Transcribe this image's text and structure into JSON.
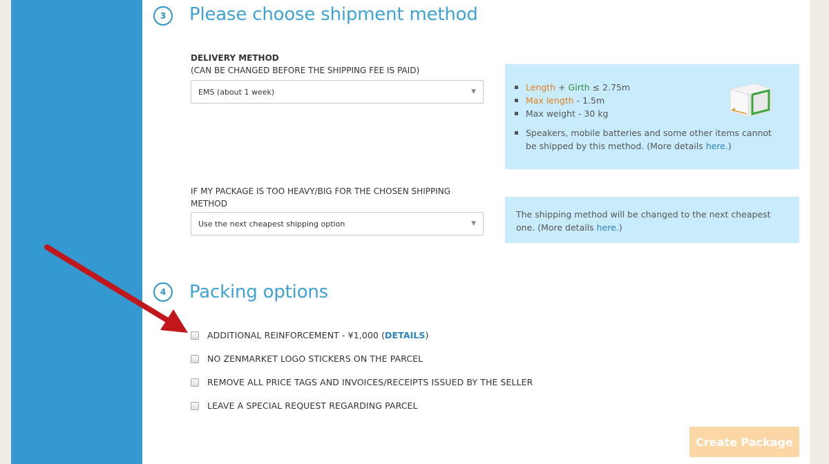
{
  "step3": {
    "number": "3",
    "title": "Please choose shipment method",
    "delivery_label": "DELIVERY METHOD",
    "delivery_sublabel": "(CAN BE CHANGED BEFORE THE SHIPPING FEE IS PAID)",
    "delivery_value": "EMS (about 1 week)",
    "info": {
      "length": "Length",
      "plus": " + ",
      "girth": "Girth",
      "girth_rest": " ≤ 2.75m",
      "max_length": "Max length",
      "max_length_rest": " -  1.5m",
      "max_weight": "Max weight - 30 kg",
      "note": "Speakers, mobile batteries and some other items cannot be shipped by this method. (More details ",
      "note_link": "here.",
      "note_end": ")"
    },
    "heavy_label": "IF MY PACKAGE IS TOO HEAVY/BIG FOR THE CHOSEN SHIPPING METHOD",
    "heavy_value": "Use the next cheapest shipping option",
    "heavy_info": "The shipping method will be changed to the next cheapest one. (More details ",
    "heavy_info_link": "here.",
    "heavy_info_end": ")"
  },
  "step4": {
    "number": "4",
    "title": "Packing options",
    "options": [
      {
        "label": "ADDITIONAL REINFORCEMENT - ¥1,000 (",
        "link": "DETAILS",
        "end": ")"
      },
      {
        "label": "NO ZENMARKET LOGO STICKERS ON THE PARCEL"
      },
      {
        "label": "REMOVE ALL PRICE TAGS AND INVOICES/RECEIPTS ISSUED BY THE SELLER"
      },
      {
        "label": "LEAVE A SPECIAL REQUEST REGARDING PARCEL"
      }
    ]
  },
  "create_button": "Create Package",
  "colors": {
    "sidebar": "#3399d0",
    "accent": "#3fa2d6",
    "info_bg": "#c8ecfb",
    "button": "#fbd7a5",
    "arrow": "#c0161c"
  },
  "icons": [
    "box-icon",
    "red-arrow",
    "dropdown-caret-icon"
  ]
}
